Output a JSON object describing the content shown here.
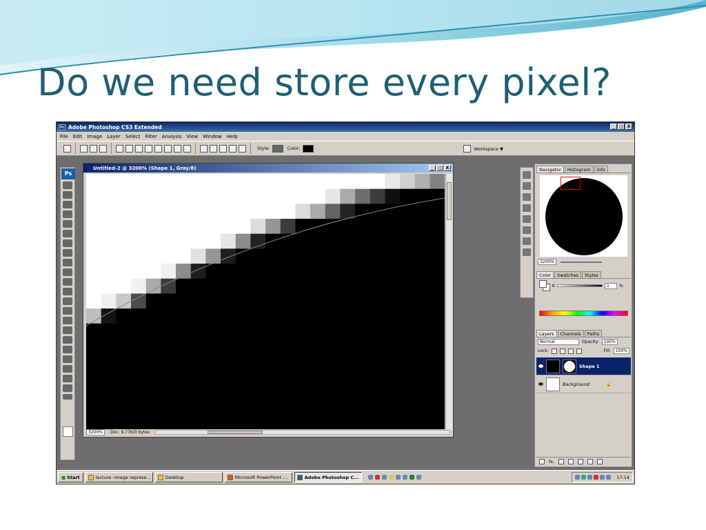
{
  "slide": {
    "title": "Do we need store every pixel?"
  },
  "window": {
    "app_title": "Adobe Photoshop CS3 Extended",
    "controls": [
      "_",
      "□",
      "X"
    ]
  },
  "menu": [
    "File",
    "Edit",
    "Image",
    "Layer",
    "Select",
    "Filter",
    "Analysis",
    "View",
    "Window",
    "Help"
  ],
  "options_bar": {
    "style_label": "Style:",
    "color_label": "Color:",
    "color_value": "#000000",
    "workspace_label": "Workspace ▼"
  },
  "document": {
    "title": "Untitled-2 @ 3200% (Shape 1, Gray/8)",
    "zoom": "3200%",
    "doc_info": "Doc: 9.77K/0 bytes",
    "pixel_rows": [
      [
        255,
        255,
        255,
        255,
        255,
        255,
        255,
        255,
        255,
        255,
        255,
        255,
        255,
        255,
        255,
        255,
        255,
        255,
        255,
        255,
        232,
        208,
        175,
        130
      ],
      [
        255,
        255,
        255,
        255,
        255,
        255,
        255,
        255,
        255,
        255,
        255,
        255,
        255,
        255,
        255,
        255,
        230,
        170,
        110,
        60,
        15,
        0,
        0,
        0
      ],
      [
        255,
        255,
        255,
        255,
        255,
        255,
        255,
        255,
        255,
        255,
        255,
        255,
        255,
        255,
        220,
        170,
        100,
        35,
        0,
        0,
        0,
        0,
        0,
        0
      ],
      [
        255,
        255,
        255,
        255,
        255,
        255,
        255,
        255,
        255,
        255,
        255,
        220,
        150,
        60,
        0,
        0,
        0,
        0,
        0,
        0,
        0,
        0,
        0,
        0
      ],
      [
        255,
        255,
        255,
        255,
        255,
        255,
        255,
        255,
        255,
        230,
        140,
        35,
        0,
        0,
        0,
        0,
        0,
        0,
        0,
        0,
        0,
        0,
        0,
        0
      ],
      [
        255,
        255,
        255,
        255,
        255,
        255,
        255,
        225,
        150,
        30,
        0,
        0,
        0,
        0,
        0,
        0,
        0,
        0,
        0,
        0,
        0,
        0,
        0,
        0
      ],
      [
        255,
        255,
        255,
        255,
        255,
        240,
        140,
        30,
        0,
        0,
        0,
        0,
        0,
        0,
        0,
        0,
        0,
        0,
        0,
        0,
        0,
        0,
        0,
        0
      ],
      [
        255,
        255,
        255,
        240,
        170,
        60,
        0,
        0,
        0,
        0,
        0,
        0,
        0,
        0,
        0,
        0,
        0,
        0,
        0,
        0,
        0,
        0,
        0,
        0
      ],
      [
        255,
        240,
        200,
        75,
        0,
        0,
        0,
        0,
        0,
        0,
        0,
        0,
        0,
        0,
        0,
        0,
        0,
        0,
        0,
        0,
        0,
        0,
        0,
        0
      ],
      [
        190,
        20,
        0,
        0,
        0,
        0,
        0,
        0,
        0,
        0,
        0,
        0,
        0,
        0,
        0,
        0,
        0,
        0,
        0,
        0,
        0,
        0,
        0,
        0
      ],
      [
        0,
        0,
        0,
        0,
        0,
        0,
        0,
        0,
        0,
        0,
        0,
        0,
        0,
        0,
        0,
        0,
        0,
        0,
        0,
        0,
        0,
        0,
        0,
        0
      ]
    ]
  },
  "panels": {
    "navigator": {
      "tabs": [
        "Navigator",
        "Histogram",
        "Info"
      ],
      "zoom": "3200%"
    },
    "color": {
      "tabs": [
        "Color",
        "Swatches",
        "Styles"
      ],
      "channel": "K",
      "value": "1",
      "unit": "%"
    },
    "layers": {
      "tabs": [
        "Layers",
        "Channels",
        "Paths"
      ],
      "blend_mode": "Normal",
      "opacity_label": "Opacity:",
      "opacity": "100%",
      "lock_label": "Lock:",
      "fill_label": "Fill:",
      "fill": "100%",
      "items": [
        {
          "name": "Shape 1",
          "selected": true
        },
        {
          "name": "Background",
          "selected": false
        }
      ],
      "footer_fx": "fx."
    }
  },
  "taskbar": {
    "start": "Start",
    "tasks": [
      {
        "label": "lecture -image represe...",
        "active": false
      },
      {
        "label": "Desktop",
        "active": false
      },
      {
        "label": "Microsoft PowerPoint -...",
        "active": false
      },
      {
        "label": "Adobe Photoshop C...",
        "active": true
      }
    ],
    "clock": "17:14"
  }
}
